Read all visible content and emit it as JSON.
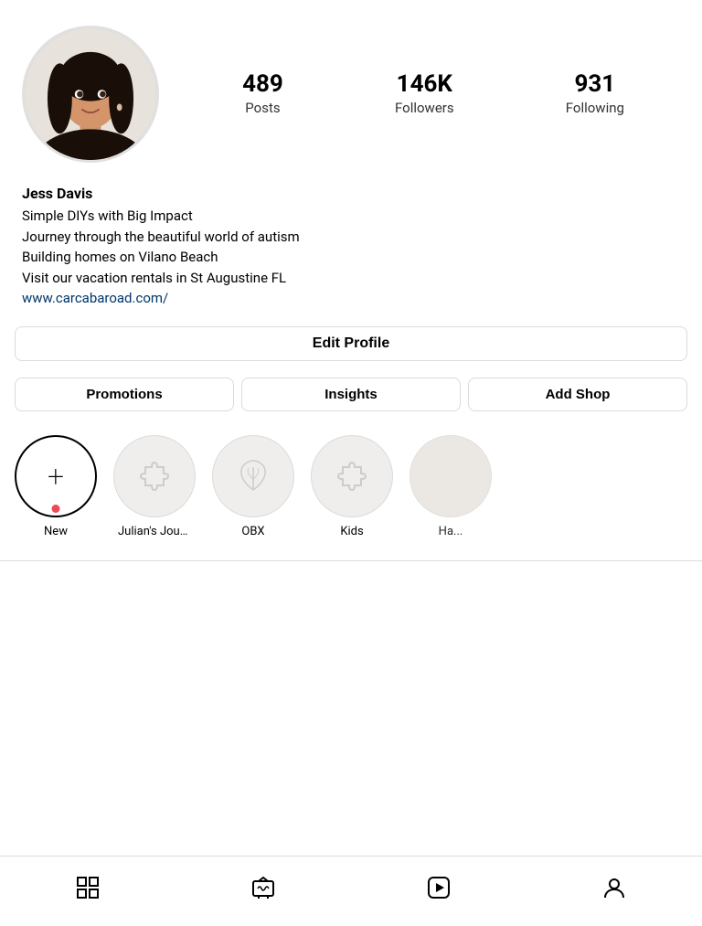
{
  "profile": {
    "name": "Jess Davis",
    "bio_lines": [
      "Simple DIYs with Big Impact",
      "Journey through the beautiful world of autism",
      "Building homes on Vilano Beach",
      "Visit our vacation rentals in St Augustine FL"
    ],
    "link": "www.carcabaroad.com/",
    "stats": {
      "posts": {
        "value": "489",
        "label": "Posts"
      },
      "followers": {
        "value": "146K",
        "label": "Followers"
      },
      "following": {
        "value": "931",
        "label": "Following"
      }
    }
  },
  "buttons": {
    "edit_profile": "Edit Profile",
    "promotions": "Promotions",
    "insights": "Insights",
    "add_shop": "Add Shop"
  },
  "highlights": [
    {
      "label": "New",
      "type": "new",
      "has_dot": true
    },
    {
      "label": "Julian's Jour...",
      "type": "puzzle"
    },
    {
      "label": "OBX",
      "type": "leaf"
    },
    {
      "label": "Kids",
      "type": "puzzle"
    },
    {
      "label": "Ha...",
      "type": "puzzle",
      "partial": true
    }
  ],
  "nav": {
    "items": [
      {
        "name": "grid",
        "icon": "grid-icon"
      },
      {
        "name": "tv",
        "icon": "tv-icon"
      },
      {
        "name": "reels",
        "icon": "play-icon"
      },
      {
        "name": "profile",
        "icon": "profile-icon"
      }
    ]
  }
}
